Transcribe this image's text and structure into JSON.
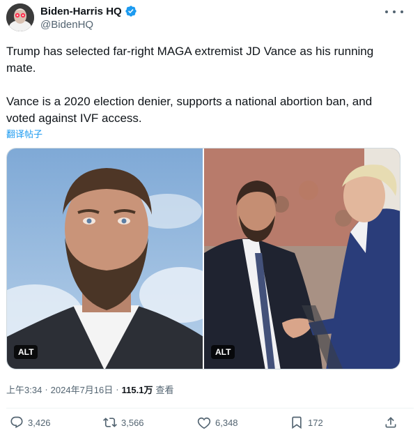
{
  "author": {
    "display_name": "Biden-Harris HQ",
    "handle": "@BidenHQ",
    "verified_color": "#1d9bf0",
    "avatar_icon": "avatar-portrait-red-glowing-eyes"
  },
  "tweet": {
    "text": "Trump has selected far-right MAGA extremist JD Vance as his running\nmate.\n\nVance is a 2020 election denier, supports a national abortion ban, and\nvoted against IVF access.",
    "translate_label": "翻译帖子"
  },
  "media": [
    {
      "alt_label": "ALT"
    },
    {
      "alt_label": "ALT"
    }
  ],
  "meta": {
    "time": "上午3:34",
    "separator": "·",
    "date": "2024年7月16日",
    "views": "115.1万",
    "views_label": "查看"
  },
  "actions": {
    "replies": "3,426",
    "reposts": "3,566",
    "likes": "6,348",
    "bookmarks": "172"
  },
  "colors": {
    "text_primary": "#0f1419",
    "text_secondary": "#536471",
    "accent": "#1d9bf0",
    "border": "#cfd9de"
  }
}
